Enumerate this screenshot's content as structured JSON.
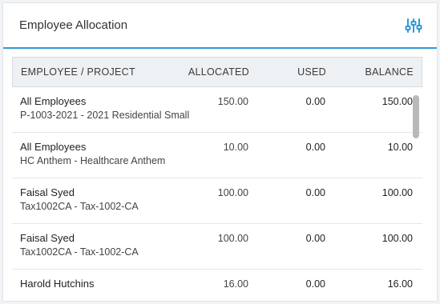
{
  "widget": {
    "title": "Employee Allocation",
    "settings_icon": "sliders-icon",
    "accent_color": "#2f9ad8"
  },
  "table": {
    "headers": {
      "name": "EMPLOYEE / PROJECT",
      "allocated": "ALLOCATED",
      "used": "USED",
      "balance": "BALANCE"
    },
    "rows": [
      {
        "employee": "All Employees",
        "project": "P-1003-2021 - 2021 Residential Small",
        "allocated": "150.00",
        "used": "0.00",
        "balance": "150.00"
      },
      {
        "employee": "All Employees",
        "project": "HC Anthem - Healthcare Anthem",
        "allocated": "10.00",
        "used": "0.00",
        "balance": "10.00"
      },
      {
        "employee": "Faisal Syed",
        "project": "Tax1002CA - Tax-1002-CA",
        "allocated": "100.00",
        "used": "0.00",
        "balance": "100.00"
      },
      {
        "employee": "Faisal Syed",
        "project": "Tax1002CA - Tax-1002-CA",
        "allocated": "100.00",
        "used": "0.00",
        "balance": "100.00"
      },
      {
        "employee": "Harold Hutchins",
        "project": "",
        "allocated": "16.00",
        "used": "0.00",
        "balance": "16.00"
      }
    ]
  }
}
